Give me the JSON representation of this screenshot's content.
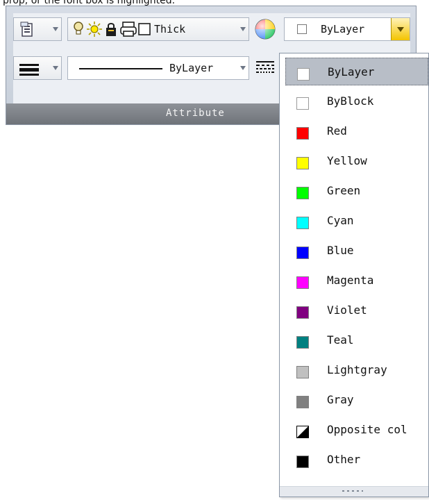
{
  "top_partial_text": "prop, or the font box is highlighted.",
  "panel": {
    "title": "Attribute"
  },
  "row1": {
    "properties_icon": "properties-icon",
    "lineweight_label": "Thick",
    "color_wheel_icon": "color-wheel-icon",
    "color_selected": "ByLayer"
  },
  "row2": {
    "linetype_label": "ByLayer",
    "linetype_icon": "linetype-icon",
    "lineweight_icon": "lineweight-icon"
  },
  "dropdown": {
    "selected": "ByLayer",
    "options": [
      {
        "label": "ByLayer",
        "color": "#ffffff"
      },
      {
        "label": "ByBlock",
        "color": "#ffffff"
      },
      {
        "label": "Red",
        "color": "#ff0000"
      },
      {
        "label": "Yellow",
        "color": "#ffff00"
      },
      {
        "label": "Green",
        "color": "#00ff00"
      },
      {
        "label": "Cyan",
        "color": "#00ffff"
      },
      {
        "label": "Blue",
        "color": "#0000ff"
      },
      {
        "label": "Magenta",
        "color": "#ff00ff"
      },
      {
        "label": "Violet",
        "color": "#800080"
      },
      {
        "label": "Teal",
        "color": "#008080"
      },
      {
        "label": "Lightgray",
        "color": "#c0c0c0"
      },
      {
        "label": "Gray",
        "color": "#808080"
      },
      {
        "label": "Opposite col",
        "color": "#ffffff"
      },
      {
        "label": "Other",
        "color": "#000000"
      }
    ]
  }
}
